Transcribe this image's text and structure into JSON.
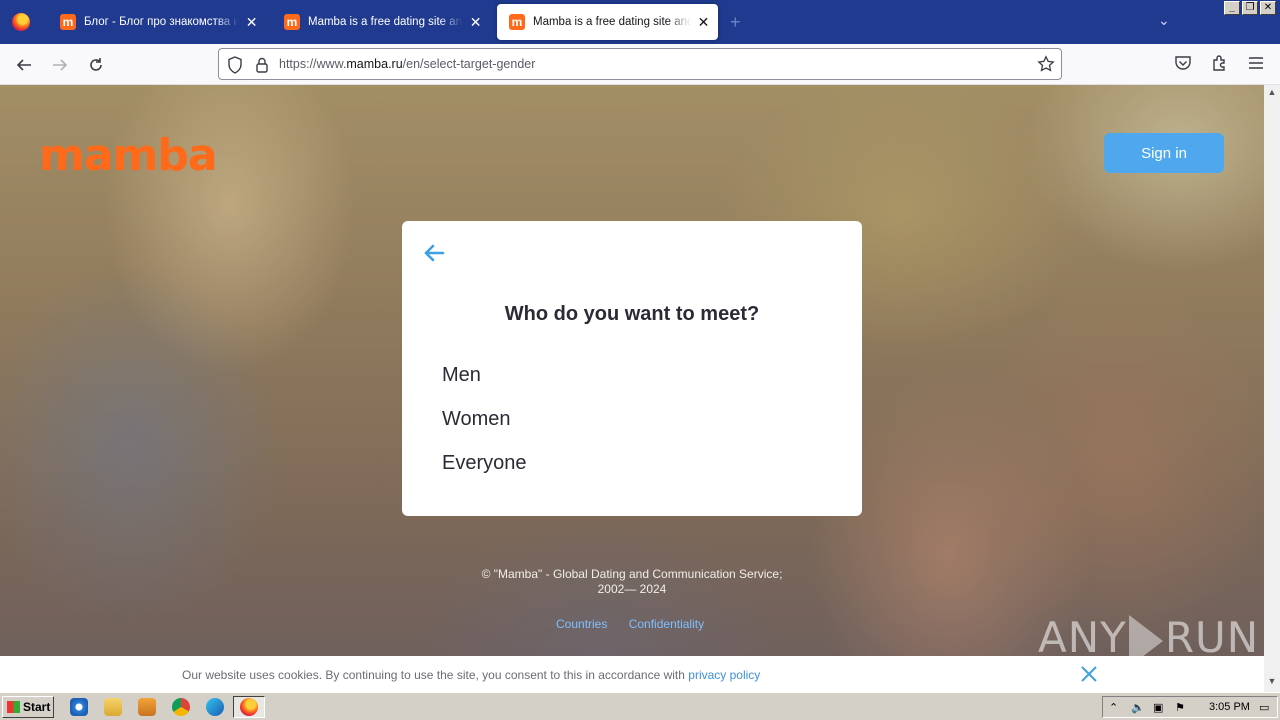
{
  "browser": {
    "tabs": [
      {
        "label": "Блог - Блог про знакомства и отношения",
        "favicon": "m",
        "active": false
      },
      {
        "label": "Mamba is a free dating site and a chat",
        "favicon": "m",
        "active": false
      },
      {
        "label": "Mamba is a free dating site and a chat",
        "favicon": "m",
        "active": true
      }
    ],
    "new_tab": "+",
    "url_prefix": "https://www.",
    "url_host": "mamba.ru",
    "url_path": "/en/select-target-gender"
  },
  "page": {
    "logo": "mamba",
    "signin_label": "Sign in",
    "modal": {
      "title": "Who do you want to meet?",
      "options": [
        "Men",
        "Women",
        "Everyone"
      ]
    },
    "footer": {
      "copyright_line1": "© \"Mamba\" - Global Dating and Communication Service;",
      "copyright_line2": "2002— 2024",
      "links": [
        "Countries",
        "Confidentiality"
      ]
    },
    "watermark": {
      "left": "ANY",
      "right": "RUN"
    },
    "cookie": {
      "text": "Our website uses cookies. By continuing to use the site, you consent to this in accordance with ",
      "link": "privacy policy"
    }
  },
  "taskbar": {
    "start_label": "Start",
    "clock": "3:05 PM"
  },
  "colors": {
    "brand": "#ff6a1a",
    "signin": "#4fa8ee",
    "tabstrip": "#1f3a8f",
    "link": "#3f8fdc",
    "back_arrow": "#3f9fe0"
  },
  "icons": [
    "firefox-icon",
    "back-icon",
    "forward-icon",
    "reload-icon",
    "shield-icon",
    "lock-icon",
    "bookmark-star-icon",
    "pocket-icon",
    "extensions-icon",
    "menu-icon",
    "close-icon",
    "arrow-left-icon"
  ]
}
